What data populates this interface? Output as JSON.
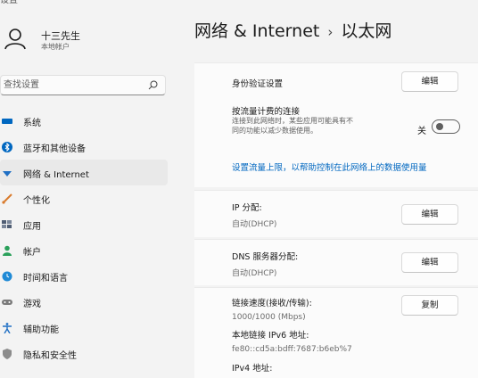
{
  "window": {
    "title_fragment": "设置"
  },
  "profile": {
    "name": "十三先生",
    "account_type": "本地帐户"
  },
  "search": {
    "placeholder": "查找设置"
  },
  "sidebar": {
    "items": [
      {
        "label": "系统",
        "icon": "monitor-icon",
        "color": "#0067c0"
      },
      {
        "label": "蓝牙和其他设备",
        "icon": "bluetooth-icon",
        "color": "#0067c0"
      },
      {
        "label": "网络 & Internet",
        "icon": "wifi-icon",
        "color": "#1f6fc4",
        "selected": true
      },
      {
        "label": "个性化",
        "icon": "brush-icon",
        "color": "#d97a2b"
      },
      {
        "label": "应用",
        "icon": "apps-icon",
        "color": "#4f5d73"
      },
      {
        "label": "帐户",
        "icon": "account-icon",
        "color": "#2aa05a"
      },
      {
        "label": "时间和语言",
        "icon": "globe-clock-icon",
        "color": "#1f8ad6"
      },
      {
        "label": "游戏",
        "icon": "gamepad-icon",
        "color": "#7a7a7a"
      },
      {
        "label": "辅助功能",
        "icon": "accessibility-icon",
        "color": "#1f6fc4"
      },
      {
        "label": "隐私和安全性",
        "icon": "shield-icon",
        "color": "#6b6b6b"
      }
    ]
  },
  "header": {
    "section": "网络 & Internet",
    "separator": "›",
    "page": "以太网"
  },
  "settings": {
    "auth": {
      "label": "身份验证设置",
      "button": "编辑"
    },
    "metered": {
      "label": "按流量计费的连接",
      "description": "连接到此网络时，某些应用可能具有不同的功能以减少数据使用。",
      "toggle_state": "关"
    },
    "data_limit_link": "设置流量上限，以帮助控制在此网络上的数据使用量",
    "ip": {
      "label": "IP 分配:",
      "value": "自动(DHCP)",
      "button": "编辑"
    },
    "dns": {
      "label": "DNS 服务器分配:",
      "value": "自动(DHCP)",
      "button": "编辑"
    },
    "link_speed": {
      "label": "链接速度(接收/传输):",
      "value": "1000/1000 (Mbps)",
      "button": "复制"
    },
    "ipv6": {
      "label": "本地链接 IPv6 地址:",
      "value": "fe80::cd5a:bdff:7687:b6eb%7"
    },
    "ipv4": {
      "label": "IPv4 地址:"
    }
  },
  "colors": {
    "accent": "#0067c0",
    "selected_bg": "#e9e9e9",
    "card_bg": "#fbfbfb"
  }
}
